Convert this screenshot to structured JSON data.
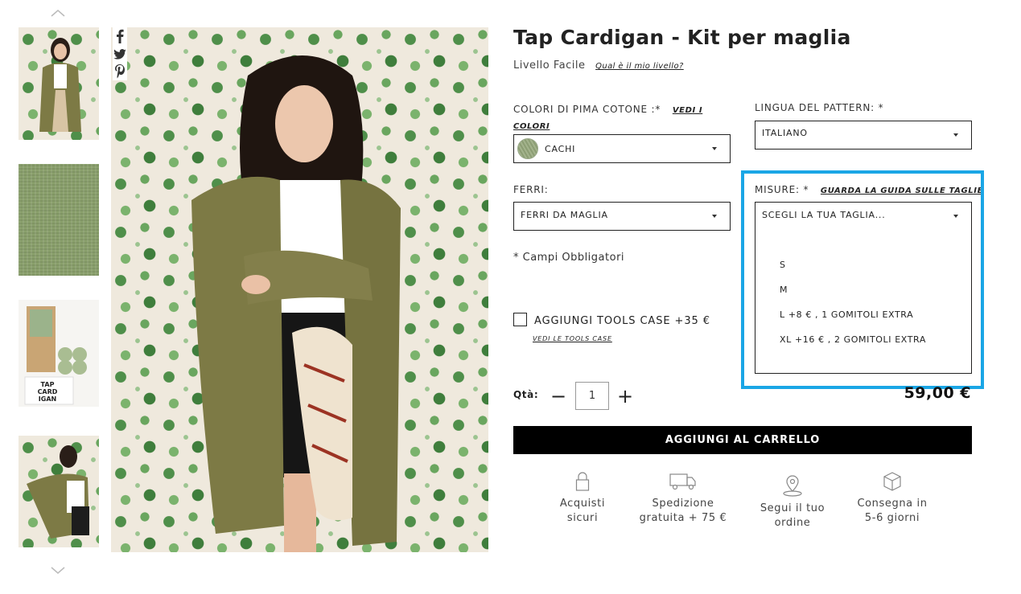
{
  "product": {
    "title": "Tap Cardigan - Kit per maglia",
    "level_text": "Livello Facile",
    "level_link": "Qual è il mio livello?"
  },
  "options": {
    "colori": {
      "label": "COLORI DI PIMA COTONE :*",
      "link": "VEDI I COLORI",
      "value": "CACHI",
      "swatch_color": "#9aaa82"
    },
    "lingua": {
      "label": "LINGUA DEL PATTERN: *",
      "value": "ITALIANO"
    },
    "ferri": {
      "label": "FERRI:",
      "value": "FERRI DA MAGLIA"
    },
    "misure": {
      "label": "MISURE: *",
      "link": "GUARDA LA GUIDA SULLE TAGLIE",
      "placeholder": "SCEGLI LA TUA TAGLIA...",
      "options": [
        "S",
        "M",
        "L +8 € , 1 GOMITOLI EXTRA",
        "XL +16 € , 2 GOMITOLI EXTRA"
      ]
    }
  },
  "required_note": "* Campi Obbligatori",
  "tools_case": {
    "label": "AGGIUNGI TOOLS CASE +35 €",
    "link": "VEDI LE TOOLS CASE"
  },
  "quantity": {
    "label": "Qtà:",
    "value": "1",
    "minus": "−",
    "plus": "+"
  },
  "price": "59,00 €",
  "cart_button": "AGGIUNGI AL CARRELLO",
  "features": [
    {
      "icon": "lock-icon",
      "line1": "Acquisti",
      "line2": "sicuri"
    },
    {
      "icon": "truck-icon",
      "line1": "Spedizione",
      "line2": "gratuita + 75 €"
    },
    {
      "icon": "location-pin-icon",
      "line1": "Segui il tuo",
      "line2": "ordine"
    },
    {
      "icon": "box-icon",
      "line1": "Consegna in",
      "line2": "5-6 giorni"
    }
  ],
  "share": [
    "facebook-icon",
    "twitter-icon",
    "pinterest-icon"
  ],
  "kit_thumb_text": "TAP CARD IGAN",
  "colors": {
    "highlight": "#1aa6e6",
    "button_bg": "#000000",
    "cardigan": "#7d7a45"
  }
}
